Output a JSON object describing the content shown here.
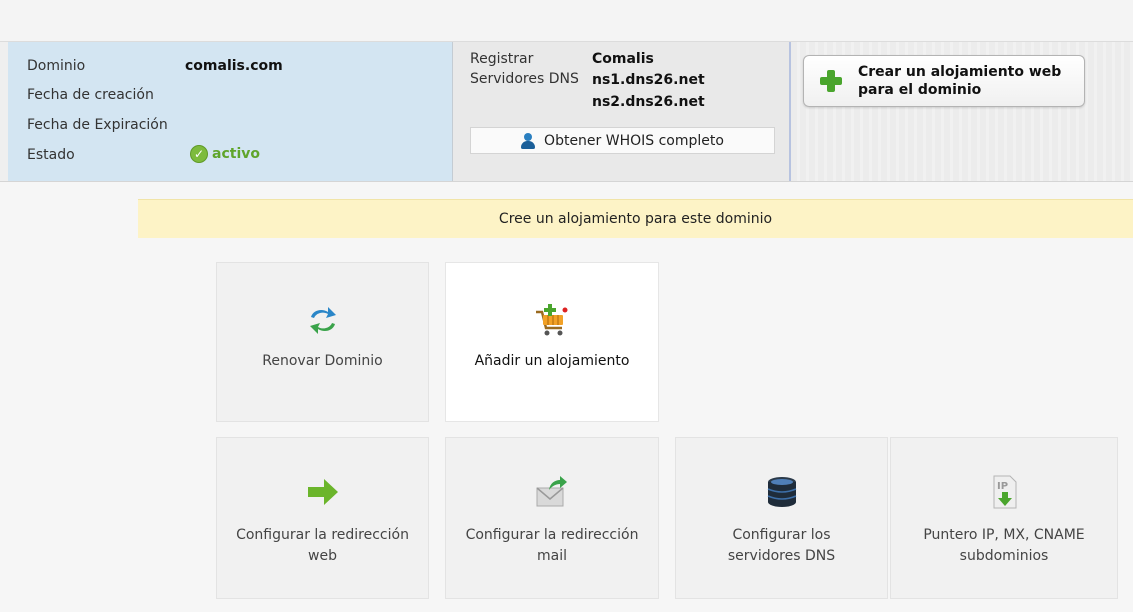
{
  "domain_info": {
    "domain_label": "Dominio",
    "domain_value": "comalis.com",
    "created_label": "Fecha de creación",
    "expiry_label": "Fecha de Expiración",
    "status_label": "Estado",
    "status_value": "activo",
    "registrar_label": "Registrar",
    "registrar_value": "Comalis",
    "dns_label": "Servidores DNS",
    "dns_servers": [
      "ns1.dns26.net",
      "ns2.dns26.net"
    ],
    "whois_button": "Obtener WHOIS completo"
  },
  "create_hosting_button": "Crear un alojamiento web\npara el dominio",
  "notice": "Cree un alojamiento para este dominio",
  "tiles": {
    "renew": "Renovar Dominio",
    "add_hosting": "Añadir un alojamiento",
    "web_redirect": "Configurar la redirección\nweb",
    "mail_redirect": "Configurar la redirección\nmail",
    "dns_servers": "Configurar los\nservidores DNS",
    "pointer": "Puntero IP, MX, CNAME\nsubdominios"
  },
  "icons": {
    "status": "check-circle-icon",
    "whois": "person-icon",
    "create_hosting": "plus-icon",
    "renew": "renew-arrows-icon",
    "add_hosting": "cart-add-icon",
    "web_redirect": "arrow-right-icon",
    "mail_redirect": "mail-forward-icon",
    "dns_servers": "database-icon",
    "pointer": "ip-download-icon",
    "pointer_badge_text": "IP"
  },
  "colors": {
    "accent_green": "#4aa52d",
    "status_green": "#5fa52b",
    "info_blue": "#d3e5f2",
    "notice_yellow": "#fdf3c6"
  }
}
